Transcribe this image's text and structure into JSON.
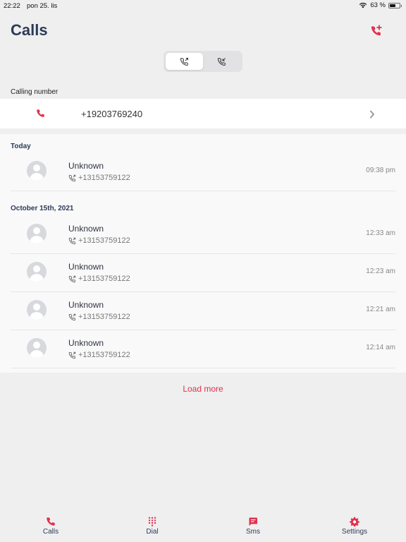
{
  "status_bar": {
    "time": "22:22",
    "date": "pon 25. lis",
    "battery": "63 %",
    "battery_level": 0.63
  },
  "page": {
    "title": "Calls"
  },
  "accent_color": "#e0314b",
  "calling_number": {
    "label": "Calling number",
    "number": "+19203769240"
  },
  "groups": [
    {
      "header": "Today",
      "calls": [
        {
          "name": "Unknown",
          "number": "+13153759122",
          "time": "09:38 pm"
        }
      ]
    },
    {
      "header": "October 15th, 2021",
      "calls": [
        {
          "name": "Unknown",
          "number": "+13153759122",
          "time": "12:33 am"
        },
        {
          "name": "Unknown",
          "number": "+13153759122",
          "time": "12:23 am"
        },
        {
          "name": "Unknown",
          "number": "+13153759122",
          "time": "12:21 am"
        },
        {
          "name": "Unknown",
          "number": "+13153759122",
          "time": "12:14 am"
        }
      ]
    }
  ],
  "load_more": "Load more",
  "tabs": [
    {
      "label": "Calls",
      "icon": "phone-icon"
    },
    {
      "label": "Dial",
      "icon": "dialpad-icon"
    },
    {
      "label": "Sms",
      "icon": "message-icon"
    },
    {
      "label": "Settings",
      "icon": "gear-icon"
    }
  ]
}
